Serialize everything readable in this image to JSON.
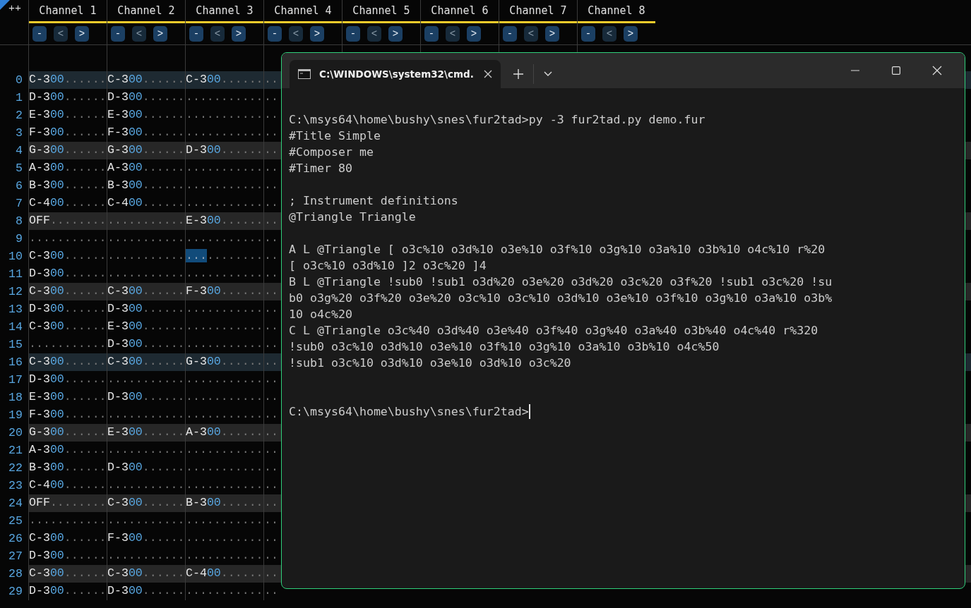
{
  "tracker": {
    "corner": "++",
    "channels": [
      {
        "name": "Channel 1",
        "buttons": [
          {
            "label": "-",
            "disabled": false
          },
          {
            "label": "<",
            "disabled": true
          },
          {
            "label": ">",
            "disabled": false
          }
        ]
      },
      {
        "name": "Channel 2",
        "buttons": [
          {
            "label": "-",
            "disabled": false
          },
          {
            "label": "<",
            "disabled": true
          },
          {
            "label": ">",
            "disabled": false
          }
        ]
      },
      {
        "name": "Channel 3",
        "buttons": [
          {
            "label": "-",
            "disabled": false
          },
          {
            "label": "<",
            "disabled": true
          },
          {
            "label": ">",
            "disabled": false
          }
        ]
      },
      {
        "name": "Channel 4",
        "buttons": [
          {
            "label": "-",
            "disabled": false
          },
          {
            "label": "<",
            "disabled": true
          },
          {
            "label": ">",
            "disabled": false
          }
        ]
      },
      {
        "name": "Channel 5",
        "buttons": [
          {
            "label": "-",
            "disabled": false
          },
          {
            "label": "<",
            "disabled": true
          },
          {
            "label": ">",
            "disabled": false
          }
        ]
      },
      {
        "name": "Channel 6",
        "buttons": [
          {
            "label": "-",
            "disabled": false
          },
          {
            "label": "<",
            "disabled": true
          },
          {
            "label": ">",
            "disabled": false
          }
        ]
      },
      {
        "name": "Channel 7",
        "buttons": [
          {
            "label": "-",
            "disabled": false
          },
          {
            "label": "<",
            "disabled": true
          },
          {
            "label": ">",
            "disabled": false
          }
        ]
      },
      {
        "name": "Channel 8",
        "buttons": [
          {
            "label": "-",
            "disabled": false
          },
          {
            "label": "<",
            "disabled": true
          },
          {
            "label": ">",
            "disabled": false
          }
        ]
      }
    ],
    "rows": [
      {
        "number": "0",
        "kind": "measure",
        "cells": [
          {
            "note": "C-3",
            "instrument": "00",
            "rest": "......",
            "selected": false
          },
          {
            "note": "C-3",
            "instrument": "00",
            "rest": "......",
            "selected": false
          },
          {
            "note": "C-3",
            "instrument": "00",
            "rest": "......",
            "selected": false
          }
        ],
        "tail": ".."
      },
      {
        "number": "1",
        "kind": "none",
        "cells": [
          {
            "note": "D-3",
            "instrument": "00",
            "rest": "......",
            "selected": false
          },
          {
            "note": "D-3",
            "instrument": "00",
            "rest": "......",
            "selected": false
          },
          {
            "rest": "...........",
            "selected": false
          }
        ],
        "tail": ".."
      },
      {
        "number": "2",
        "kind": "none",
        "cells": [
          {
            "note": "E-3",
            "instrument": "00",
            "rest": "......",
            "selected": false
          },
          {
            "note": "E-3",
            "instrument": "00",
            "rest": "......",
            "selected": false
          },
          {
            "rest": "...........",
            "selected": false
          }
        ],
        "tail": ".."
      },
      {
        "number": "3",
        "kind": "none",
        "cells": [
          {
            "note": "F-3",
            "instrument": "00",
            "rest": "......",
            "selected": false
          },
          {
            "note": "F-3",
            "instrument": "00",
            "rest": "......",
            "selected": false
          },
          {
            "rest": "...........",
            "selected": false
          }
        ],
        "tail": ".."
      },
      {
        "number": "4",
        "kind": "beat",
        "cells": [
          {
            "note": "G-3",
            "instrument": "00",
            "rest": "......",
            "selected": false
          },
          {
            "note": "G-3",
            "instrument": "00",
            "rest": "......",
            "selected": false
          },
          {
            "note": "D-3",
            "instrument": "00",
            "rest": "......",
            "selected": false
          }
        ],
        "tail": ".."
      },
      {
        "number": "5",
        "kind": "none",
        "cells": [
          {
            "note": "A-3",
            "instrument": "00",
            "rest": "......",
            "selected": false
          },
          {
            "note": "A-3",
            "instrument": "00",
            "rest": "......",
            "selected": false
          },
          {
            "rest": "...........",
            "selected": false
          }
        ],
        "tail": ".."
      },
      {
        "number": "6",
        "kind": "none",
        "cells": [
          {
            "note": "B-3",
            "instrument": "00",
            "rest": "......",
            "selected": false
          },
          {
            "note": "B-3",
            "instrument": "00",
            "rest": "......",
            "selected": false
          },
          {
            "rest": "...........",
            "selected": false
          }
        ],
        "tail": ".."
      },
      {
        "number": "7",
        "kind": "none",
        "cells": [
          {
            "note": "C-4",
            "instrument": "00",
            "rest": "......",
            "selected": false
          },
          {
            "note": "C-4",
            "instrument": "00",
            "rest": "......",
            "selected": false
          },
          {
            "rest": "...........",
            "selected": false
          }
        ],
        "tail": ".."
      },
      {
        "number": "8",
        "kind": "beat",
        "cells": [
          {
            "note": "OFF",
            "rest": "........",
            "selected": false
          },
          {
            "rest": "...........",
            "selected": false
          },
          {
            "note": "E-3",
            "instrument": "00",
            "rest": "......",
            "selected": false
          }
        ],
        "tail": ".."
      },
      {
        "number": "9",
        "kind": "none",
        "cells": [
          {
            "rest": "...........",
            "selected": false
          },
          {
            "rest": "...........",
            "selected": false
          },
          {
            "rest": "...........",
            "selected": false
          }
        ],
        "tail": ".."
      },
      {
        "number": "10",
        "kind": "none",
        "cells": [
          {
            "note": "C-3",
            "instrument": "00",
            "rest": "......",
            "selected": false
          },
          {
            "rest": "...........",
            "selected": false
          },
          {
            "rest": "...........",
            "selected": true
          }
        ],
        "tail": ".."
      },
      {
        "number": "11",
        "kind": "none",
        "cells": [
          {
            "note": "D-3",
            "instrument": "00",
            "rest": "......",
            "selected": false
          },
          {
            "rest": "...........",
            "selected": false
          },
          {
            "rest": "...........",
            "selected": false
          }
        ],
        "tail": ".."
      },
      {
        "number": "12",
        "kind": "beat",
        "cells": [
          {
            "note": "C-3",
            "instrument": "00",
            "rest": "......",
            "selected": false
          },
          {
            "note": "C-3",
            "instrument": "00",
            "rest": "......",
            "selected": false
          },
          {
            "note": "F-3",
            "instrument": "00",
            "rest": "......",
            "selected": false
          }
        ],
        "tail": ".."
      },
      {
        "number": "13",
        "kind": "none",
        "cells": [
          {
            "note": "D-3",
            "instrument": "00",
            "rest": "......",
            "selected": false
          },
          {
            "note": "D-3",
            "instrument": "00",
            "rest": "......",
            "selected": false
          },
          {
            "rest": "...........",
            "selected": false
          }
        ],
        "tail": ".."
      },
      {
        "number": "14",
        "kind": "none",
        "cells": [
          {
            "note": "C-3",
            "instrument": "00",
            "rest": "......",
            "selected": false
          },
          {
            "note": "E-3",
            "instrument": "00",
            "rest": "......",
            "selected": false
          },
          {
            "rest": "...........",
            "selected": false
          }
        ],
        "tail": ".."
      },
      {
        "number": "15",
        "kind": "none",
        "cells": [
          {
            "rest": "...........",
            "selected": false
          },
          {
            "note": "D-3",
            "instrument": "00",
            "rest": "......",
            "selected": false
          },
          {
            "rest": "...........",
            "selected": false
          }
        ],
        "tail": ".."
      },
      {
        "number": "16",
        "kind": "measure",
        "cells": [
          {
            "note": "C-3",
            "instrument": "00",
            "rest": "......",
            "selected": false
          },
          {
            "note": "C-3",
            "instrument": "00",
            "rest": "......",
            "selected": false
          },
          {
            "note": "G-3",
            "instrument": "00",
            "rest": "......",
            "selected": false
          }
        ],
        "tail": ".."
      },
      {
        "number": "17",
        "kind": "none",
        "cells": [
          {
            "note": "D-3",
            "instrument": "00",
            "rest": "......",
            "selected": false
          },
          {
            "rest": "...........",
            "selected": false
          },
          {
            "rest": "...........",
            "selected": false
          }
        ],
        "tail": ".."
      },
      {
        "number": "18",
        "kind": "none",
        "cells": [
          {
            "note": "E-3",
            "instrument": "00",
            "rest": "......",
            "selected": false
          },
          {
            "note": "D-3",
            "instrument": "00",
            "rest": "......",
            "selected": false
          },
          {
            "rest": "...........",
            "selected": false
          }
        ],
        "tail": ".."
      },
      {
        "number": "19",
        "kind": "none",
        "cells": [
          {
            "note": "F-3",
            "instrument": "00",
            "rest": "......",
            "selected": false
          },
          {
            "rest": "...........",
            "selected": false
          },
          {
            "rest": "...........",
            "selected": false
          }
        ],
        "tail": ".."
      },
      {
        "number": "20",
        "kind": "beat",
        "cells": [
          {
            "note": "G-3",
            "instrument": "00",
            "rest": "......",
            "selected": false
          },
          {
            "note": "E-3",
            "instrument": "00",
            "rest": "......",
            "selected": false
          },
          {
            "note": "A-3",
            "instrument": "00",
            "rest": "......",
            "selected": false
          }
        ],
        "tail": ".."
      },
      {
        "number": "21",
        "kind": "none",
        "cells": [
          {
            "note": "A-3",
            "instrument": "00",
            "rest": "......",
            "selected": false
          },
          {
            "rest": "...........",
            "selected": false
          },
          {
            "rest": "...........",
            "selected": false
          }
        ],
        "tail": ".."
      },
      {
        "number": "22",
        "kind": "none",
        "cells": [
          {
            "note": "B-3",
            "instrument": "00",
            "rest": "......",
            "selected": false
          },
          {
            "note": "D-3",
            "instrument": "00",
            "rest": "......",
            "selected": false
          },
          {
            "rest": "...........",
            "selected": false
          }
        ],
        "tail": ".."
      },
      {
        "number": "23",
        "kind": "none",
        "cells": [
          {
            "note": "C-4",
            "instrument": "00",
            "rest": "......",
            "selected": false
          },
          {
            "rest": "...........",
            "selected": false
          },
          {
            "rest": "...........",
            "selected": false
          }
        ],
        "tail": ".."
      },
      {
        "number": "24",
        "kind": "beat",
        "cells": [
          {
            "note": "OFF",
            "rest": "........",
            "selected": false
          },
          {
            "note": "C-3",
            "instrument": "00",
            "rest": "......",
            "selected": false
          },
          {
            "note": "B-3",
            "instrument": "00",
            "rest": "......",
            "selected": false
          }
        ],
        "tail": ".."
      },
      {
        "number": "25",
        "kind": "none",
        "cells": [
          {
            "rest": "...........",
            "selected": false
          },
          {
            "rest": "...........",
            "selected": false
          },
          {
            "rest": "...........",
            "selected": false
          }
        ],
        "tail": ".."
      },
      {
        "number": "26",
        "kind": "none",
        "cells": [
          {
            "note": "C-3",
            "instrument": "00",
            "rest": "......",
            "selected": false
          },
          {
            "note": "F-3",
            "instrument": "00",
            "rest": "......",
            "selected": false
          },
          {
            "rest": "...........",
            "selected": false
          }
        ],
        "tail": ".."
      },
      {
        "number": "27",
        "kind": "none",
        "cells": [
          {
            "note": "D-3",
            "instrument": "00",
            "rest": "......",
            "selected": false
          },
          {
            "rest": "...........",
            "selected": false
          },
          {
            "rest": "...........",
            "selected": false
          }
        ],
        "tail": ".."
      },
      {
        "number": "28",
        "kind": "beat",
        "cells": [
          {
            "note": "C-3",
            "instrument": "00",
            "rest": "......",
            "selected": false
          },
          {
            "note": "C-3",
            "instrument": "00",
            "rest": "......",
            "selected": false
          },
          {
            "note": "C-4",
            "instrument": "00",
            "rest": "......",
            "selected": false
          }
        ],
        "tail": ".."
      },
      {
        "number": "29",
        "kind": "none",
        "cells": [
          {
            "note": "D-3",
            "instrument": "00",
            "rest": "......",
            "selected": false
          },
          {
            "note": "D-3",
            "instrument": "00",
            "rest": "......",
            "selected": false
          },
          {
            "rest": "...........",
            "selected": false
          }
        ],
        "tail": ".."
      }
    ]
  },
  "terminal": {
    "tab_title": "C:\\WINDOWS\\system32\\cmd.",
    "lines": [
      {
        "kind": "blank"
      },
      {
        "kind": "text",
        "text": "C:\\msys64\\home\\bushy\\snes\\fur2tad>py -3 fur2tad.py demo.fur"
      },
      {
        "kind": "text",
        "text": "#Title Simple"
      },
      {
        "kind": "text",
        "text": "#Composer me"
      },
      {
        "kind": "text",
        "text": "#Timer 80"
      },
      {
        "kind": "blank"
      },
      {
        "kind": "text",
        "text": "; Instrument definitions"
      },
      {
        "kind": "text",
        "text": "@Triangle Triangle"
      },
      {
        "kind": "blank"
      },
      {
        "kind": "text",
        "text": "A L @Triangle [ o3c%10 o3d%10 o3e%10 o3f%10 o3g%10 o3a%10 o3b%10 o4c%10 r%20"
      },
      {
        "kind": "text",
        "text": "[ o3c%10 o3d%10 ]2 o3c%20 ]4"
      },
      {
        "kind": "text",
        "text": "B L @Triangle !sub0 !sub1 o3d%20 o3e%20 o3d%20 o3c%20 o3f%20 !sub1 o3c%20 !su"
      },
      {
        "kind": "text",
        "text": "b0 o3g%20 o3f%20 o3e%20 o3c%10 o3c%10 o3d%10 o3e%10 o3f%10 o3g%10 o3a%10 o3b%"
      },
      {
        "kind": "text",
        "text": "10 o4c%20"
      },
      {
        "kind": "text",
        "text": "C L @Triangle o3c%40 o3d%40 o3e%40 o3f%40 o3g%40 o3a%40 o3b%40 o4c%40 r%320"
      },
      {
        "kind": "text",
        "text": "!sub0 o3c%10 o3d%10 o3e%10 o3f%10 o3g%10 o3a%10 o3b%10 o4c%50"
      },
      {
        "kind": "text",
        "text": "!sub1 o3c%10 o3d%10 o3e%10 o3d%10 o3c%20"
      },
      {
        "kind": "blank"
      },
      {
        "kind": "blank"
      },
      {
        "kind": "prompt",
        "text": "C:\\msys64\\home\\bushy\\snes\\fur2tad>"
      }
    ]
  }
}
